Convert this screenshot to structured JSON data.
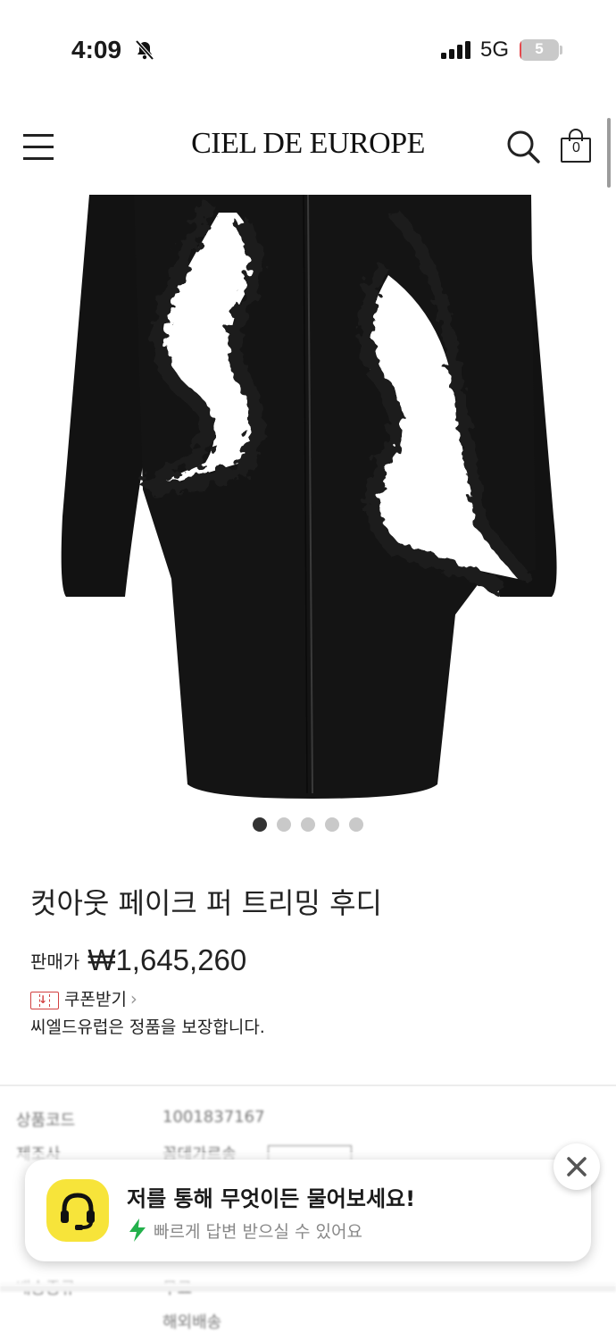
{
  "status_bar": {
    "time": "4:09",
    "network": "5G",
    "battery": "5",
    "battery_level": 0.05
  },
  "header": {
    "logo": "CIEL DE EUROPE",
    "cart_count": "0"
  },
  "gallery": {
    "total_images": 5,
    "active_index": 0
  },
  "product": {
    "name": "컷아웃 페이크 퍼 트리밍 후디",
    "price_label": "판매가",
    "price": "₩1,645,260",
    "coupon_label": "쿠폰받기",
    "genuine_notice": "씨엘드유럽은 정품을 보장합니다."
  },
  "info_table": {
    "rows": [
      {
        "label": "상품코드",
        "value": "1001837167"
      },
      {
        "label": "제조사",
        "value": "꼼데가르송"
      },
      {
        "label": "배송종류",
        "value": "무료"
      },
      {
        "label": "",
        "value": "해외배송"
      }
    ]
  },
  "chat_popup": {
    "title": "저를 통해 무엇이든 물어보세요!",
    "subtitle": "빠르게 답변 받으실 수 있어요"
  },
  "colors": {
    "accent_yellow": "#f7e43a",
    "coupon_red": "#d24040",
    "bolt_green": "#22b04b"
  }
}
